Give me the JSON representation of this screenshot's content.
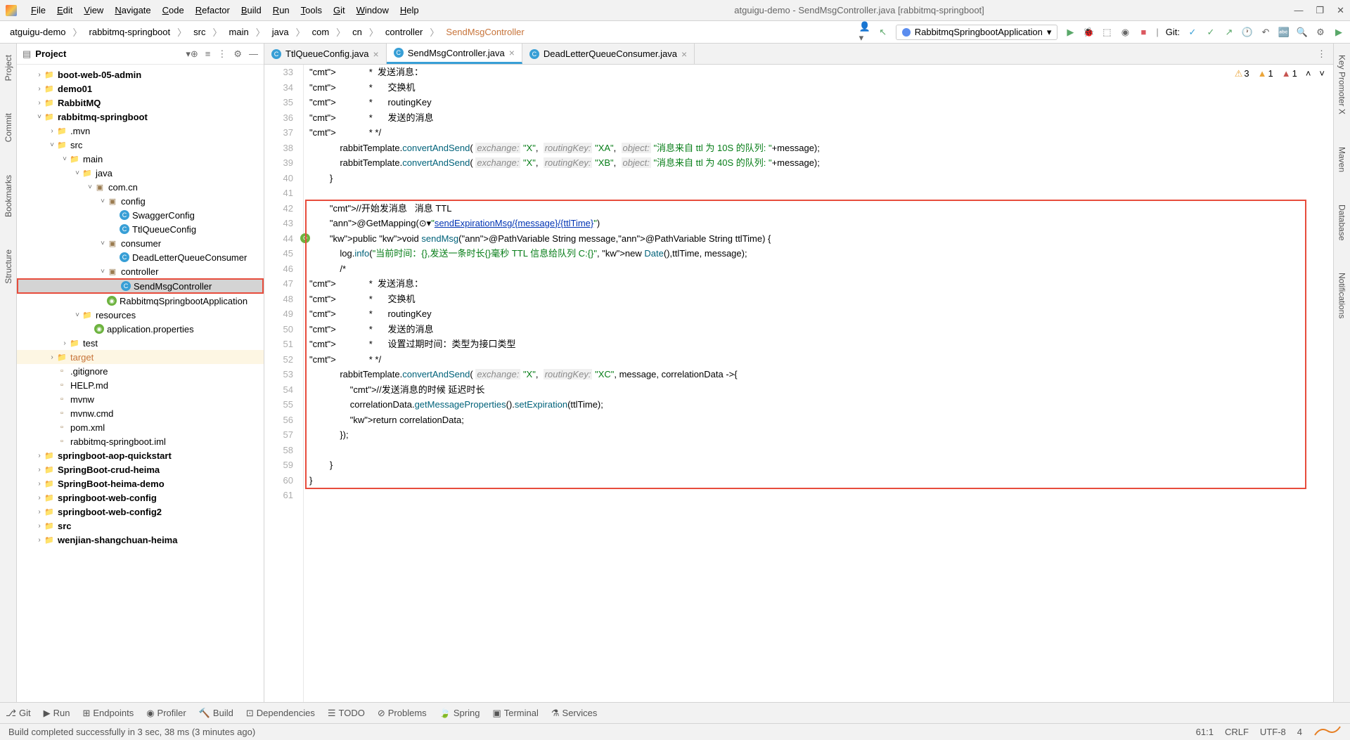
{
  "window": {
    "title": "atguigu-demo - SendMsgController.java [rabbitmq-springboot]"
  },
  "menu": [
    "File",
    "Edit",
    "View",
    "Navigate",
    "Code",
    "Refactor",
    "Build",
    "Run",
    "Tools",
    "Git",
    "Window",
    "Help"
  ],
  "breadcrumb": [
    "atguigu-demo",
    "rabbitmq-springboot",
    "src",
    "main",
    "java",
    "com",
    "cn",
    "controller",
    "SendMsgController"
  ],
  "run_config": "RabbitmqSpringbootApplication",
  "git_label": "Git:",
  "sidebar": {
    "title": "Project",
    "nodes": [
      {
        "indent": 1,
        "arrow": ">",
        "icon": "folder",
        "label": "boot-web-05-admin",
        "bold": true
      },
      {
        "indent": 1,
        "arrow": ">",
        "icon": "folder",
        "label": "demo01",
        "bold": true
      },
      {
        "indent": 1,
        "arrow": ">",
        "icon": "folder",
        "label": "RabbitMQ",
        "bold": true
      },
      {
        "indent": 1,
        "arrow": "v",
        "icon": "folder",
        "label": "rabbitmq-springboot",
        "bold": true
      },
      {
        "indent": 2,
        "arrow": ">",
        "icon": "folder",
        "label": ".mvn"
      },
      {
        "indent": 2,
        "arrow": "v",
        "icon": "folder",
        "label": "src"
      },
      {
        "indent": 3,
        "arrow": "v",
        "icon": "folder",
        "label": "main"
      },
      {
        "indent": 4,
        "arrow": "v",
        "icon": "folder",
        "label": "java"
      },
      {
        "indent": 5,
        "arrow": "v",
        "icon": "pkg",
        "label": "com.cn"
      },
      {
        "indent": 6,
        "arrow": "v",
        "icon": "pkg",
        "label": "config"
      },
      {
        "indent": 7,
        "arrow": "",
        "icon": "class",
        "label": "SwaggerConfig"
      },
      {
        "indent": 7,
        "arrow": "",
        "icon": "class",
        "label": "TtlQueueConfig"
      },
      {
        "indent": 6,
        "arrow": "v",
        "icon": "pkg",
        "label": "consumer"
      },
      {
        "indent": 7,
        "arrow": "",
        "icon": "class",
        "label": "DeadLetterQueueConsumer"
      },
      {
        "indent": 6,
        "arrow": "v",
        "icon": "pkg",
        "label": "controller"
      },
      {
        "indent": 7,
        "arrow": "",
        "icon": "class",
        "label": "SendMsgController",
        "selected": true,
        "highlighted": true
      },
      {
        "indent": 6,
        "arrow": "",
        "icon": "spring",
        "label": "RabbitmqSpringbootApplication"
      },
      {
        "indent": 4,
        "arrow": "v",
        "icon": "folder",
        "label": "resources"
      },
      {
        "indent": 5,
        "arrow": "",
        "icon": "spring",
        "label": "application.properties"
      },
      {
        "indent": 3,
        "arrow": ">",
        "icon": "folder",
        "label": "test"
      },
      {
        "indent": 2,
        "arrow": ">",
        "icon": "folder",
        "label": "target",
        "orange": true,
        "target": true
      },
      {
        "indent": 2,
        "arrow": "",
        "icon": "file",
        "label": ".gitignore"
      },
      {
        "indent": 2,
        "arrow": "",
        "icon": "file",
        "label": "HELP.md"
      },
      {
        "indent": 2,
        "arrow": "",
        "icon": "file",
        "label": "mvnw"
      },
      {
        "indent": 2,
        "arrow": "",
        "icon": "file",
        "label": "mvnw.cmd"
      },
      {
        "indent": 2,
        "arrow": "",
        "icon": "file",
        "label": "pom.xml"
      },
      {
        "indent": 2,
        "arrow": "",
        "icon": "file",
        "label": "rabbitmq-springboot.iml"
      },
      {
        "indent": 1,
        "arrow": ">",
        "icon": "folder",
        "label": "springboot-aop-quickstart",
        "bold": true
      },
      {
        "indent": 1,
        "arrow": ">",
        "icon": "folder",
        "label": "SpringBoot-crud-heima",
        "bold": true
      },
      {
        "indent": 1,
        "arrow": ">",
        "icon": "folder",
        "label": "SpringBoot-heima-demo",
        "bold": true
      },
      {
        "indent": 1,
        "arrow": ">",
        "icon": "folder",
        "label": "springboot-web-config",
        "bold": true
      },
      {
        "indent": 1,
        "arrow": ">",
        "icon": "folder",
        "label": "springboot-web-config2",
        "bold": true
      },
      {
        "indent": 1,
        "arrow": ">",
        "icon": "folder",
        "label": "src",
        "bold": true
      },
      {
        "indent": 1,
        "arrow": ">",
        "icon": "folder",
        "label": "wenjian-shangchuan-heima",
        "bold": true
      }
    ]
  },
  "tabs": [
    {
      "label": "TtlQueueConfig.java"
    },
    {
      "label": "SendMsgController.java",
      "active": true
    },
    {
      "label": "DeadLetterQueueConsumer.java"
    }
  ],
  "gutter": {
    "start": 33,
    "end": 61,
    "markers": [
      {
        "line": 44
      }
    ]
  },
  "inspect": {
    "critical": 3,
    "warn": 1,
    "weak": 1
  },
  "code": {
    "lines": [
      "             *  发送消息：",
      "             *      交换机",
      "             *      routingKey",
      "             *      发送的消息",
      "             * */",
      "            rabbitTemplate.convertAndSend( exchange: \"X\",  routingKey: \"XA\",  object: \"消息来自 ttl 为 10S 的队列: \"+message);",
      "            rabbitTemplate.convertAndSend( exchange: \"X\",  routingKey: \"XB\",  object: \"消息来自 ttl 为 40S 的队列: \"+message);",
      "        }",
      "",
      "        //开始发消息   消息 TTL",
      "        @GetMapping(⊙▾\"sendExpirationMsg/{message}/{ttlTime}\")",
      "        public void sendMsg(@PathVariable String message,@PathVariable String ttlTime) {",
      "            log.info(\"当前时间：{},发送一条时长{}毫秒 TTL 信息给队列 C:{}\", new Date(),ttlTime, message);",
      "            /*",
      "             *  发送消息：",
      "             *      交换机",
      "             *      routingKey",
      "             *      发送的消息",
      "             *      设置过期时间：类型为接口类型",
      "             * */",
      "            rabbitTemplate.convertAndSend( exchange: \"X\",  routingKey: \"XC\", message, correlationData ->{",
      "                //发送消息的时候 延迟时长",
      "                correlationData.getMessageProperties().setExpiration(ttlTime);",
      "                return correlationData;",
      "            });",
      "",
      "        }",
      "}",
      ""
    ]
  },
  "bottom": [
    "Git",
    "Run",
    "Endpoints",
    "Profiler",
    "Build",
    "Dependencies",
    "TODO",
    "Problems",
    "Spring",
    "Terminal",
    "Services"
  ],
  "status": {
    "msg": "Build completed successfully in 3 sec, 38 ms (3 minutes ago)",
    "pos": "61:1",
    "eol": "CRLF",
    "enc": "UTF-8",
    "spaces": "4"
  },
  "left_tabs": [
    "Project",
    "Commit",
    "Bookmarks",
    "Structure"
  ],
  "right_tabs": [
    "Key Promoter X",
    "Maven",
    "Database",
    "Notifications"
  ]
}
